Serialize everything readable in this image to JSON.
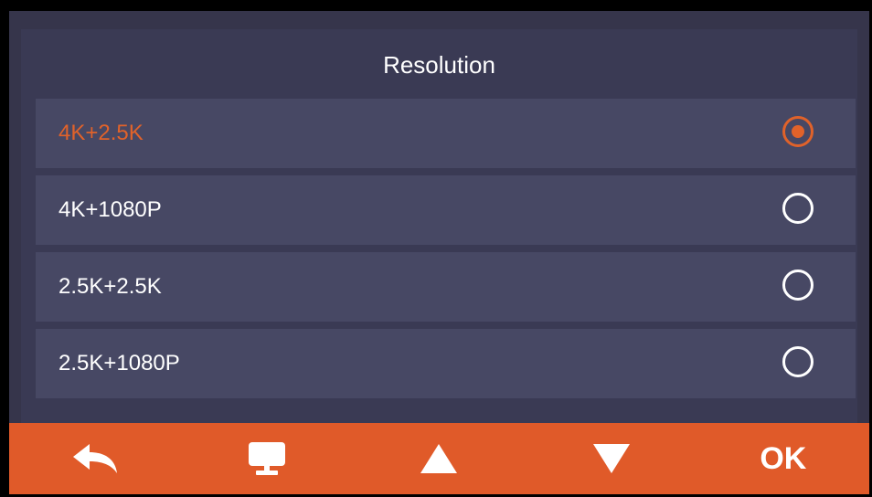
{
  "header": {
    "title": "Resolution"
  },
  "options": [
    {
      "label": "4K+2.5K",
      "selected": true
    },
    {
      "label": "4K+1080P",
      "selected": false
    },
    {
      "label": "2.5K+2.5K",
      "selected": false
    },
    {
      "label": "2.5K+1080P",
      "selected": false
    }
  ],
  "toolbar": {
    "buttons": [
      {
        "icon": "back-arrow-icon"
      },
      {
        "icon": "monitor-icon"
      },
      {
        "icon": "up-triangle-icon"
      },
      {
        "icon": "down-triangle-icon"
      }
    ],
    "ok_label": "OK"
  },
  "colors": {
    "accent": "#e05a29",
    "selected_text": "#e0622a",
    "background": "#36354b",
    "row": "#474864",
    "text": "#ffffff"
  }
}
